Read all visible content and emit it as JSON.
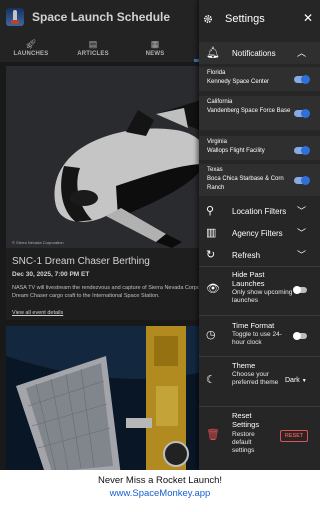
{
  "app": {
    "title": "Space Launch Schedule"
  },
  "tabs": [
    {
      "label": "LAUNCHES",
      "icon": "rocket-icon"
    },
    {
      "label": "ARTICLES",
      "icon": "newspaper-icon"
    },
    {
      "label": "NEWS",
      "icon": "news-icon"
    }
  ],
  "feed": {
    "items": [
      {
        "image_credit": "© Sierra Nevada Corporation",
        "title": "SNC-1 Dream Chaser Berthing",
        "date": "Dec 30, 2025, 7:00 PM ET",
        "description": "NASA TV will livestream the rendezvous and capture of Sierra Nevada Corporation's Dream Chaser cargo craft to the International Space Station.",
        "link": "View all event details"
      }
    ]
  },
  "settings": {
    "title": "Settings",
    "notifications": {
      "label": "Notifications",
      "items": [
        {
          "name": "Florida",
          "detail": "Kennedy Space Center",
          "enabled": true
        },
        {
          "name": "California",
          "detail": "Vandenberg Space Force Base",
          "enabled": true
        },
        {
          "name": "Virginia",
          "detail": "Wallops Flight Facility",
          "enabled": true
        },
        {
          "name": "Texas",
          "detail": "Boca Chica Starbase & Corn Ranch",
          "enabled": true
        }
      ]
    },
    "location_filters": "Location Filters",
    "agency_filters": "Agency Filters",
    "refresh": "Refresh",
    "hide_past": {
      "title": "Hide Past Launches",
      "description": "Only show upcoming launches",
      "enabled": false
    },
    "time_format": {
      "title": "Time Format",
      "description": "Toggle to use 24-hour clock",
      "enabled": false
    },
    "theme": {
      "title": "Theme",
      "description": "Choose your preferred theme",
      "value": "Dark"
    },
    "reset": {
      "title": "Reset Settings",
      "description": "Restore default settings",
      "button": "RESET"
    }
  },
  "banner": {
    "line1": "Never Miss a Rocket Launch!",
    "line2": "www.SpaceMonkey.app"
  },
  "colors": {
    "accent": "#2f6fd9",
    "danger": "#e05050",
    "drawer_bg": "#262626"
  }
}
